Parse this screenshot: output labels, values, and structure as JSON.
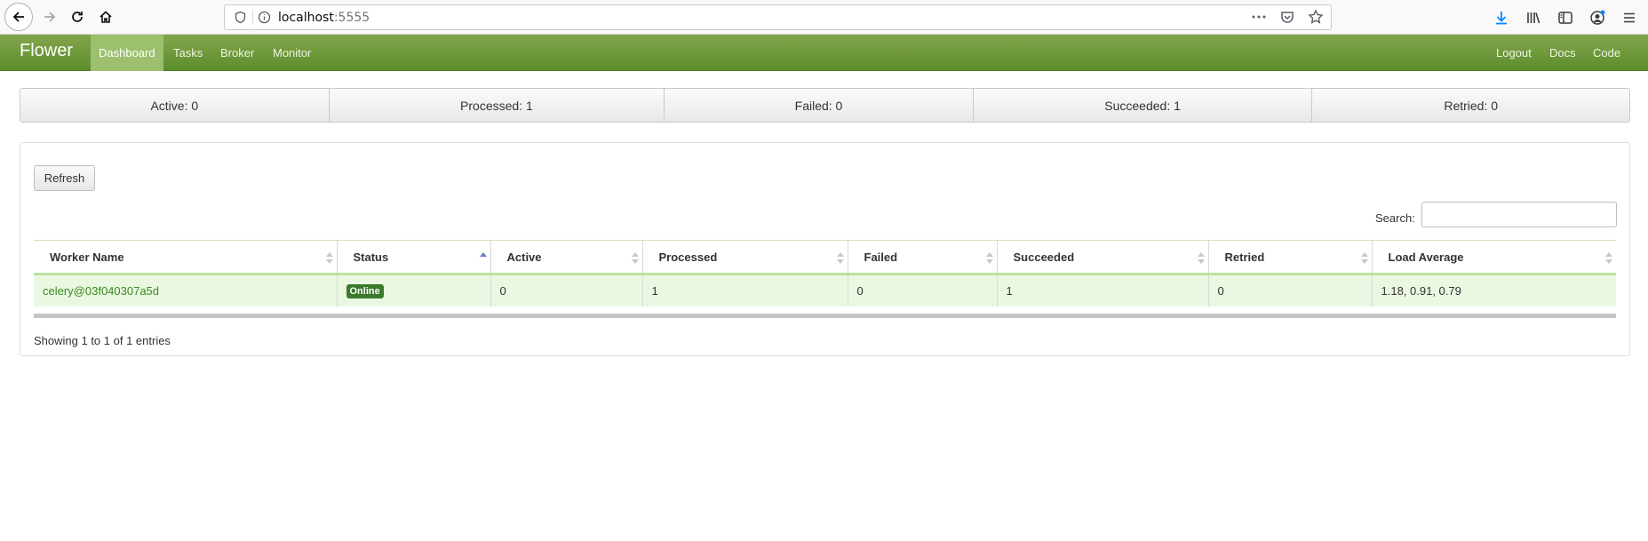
{
  "browser": {
    "url_host": "localhost",
    "url_port": ":5555"
  },
  "navbar": {
    "brand": "Flower",
    "items": [
      {
        "label": "Dashboard"
      },
      {
        "label": "Tasks"
      },
      {
        "label": "Broker"
      },
      {
        "label": "Monitor"
      }
    ],
    "right_items": [
      {
        "label": "Logout"
      },
      {
        "label": "Docs"
      },
      {
        "label": "Code"
      }
    ],
    "accent_color": "#6b9a3a"
  },
  "stats": [
    {
      "label": "Active: 0"
    },
    {
      "label": "Processed: 1"
    },
    {
      "label": "Failed: 0"
    },
    {
      "label": "Succeeded: 1"
    },
    {
      "label": "Retried: 0"
    }
  ],
  "panel": {
    "refresh_label": "Refresh",
    "search_label": "Search:",
    "search_value": "",
    "info": "Showing 1 to 1 of 1 entries"
  },
  "table": {
    "columns": [
      {
        "label": "Worker Name"
      },
      {
        "label": "Status"
      },
      {
        "label": "Active"
      },
      {
        "label": "Processed"
      },
      {
        "label": "Failed"
      },
      {
        "label": "Succeeded"
      },
      {
        "label": "Retried"
      },
      {
        "label": "Load Average"
      }
    ],
    "rows": [
      {
        "worker": "celery@03f040307a5d",
        "status": "Online",
        "active": "0",
        "processed": "1",
        "failed": "0",
        "succeeded": "1",
        "retried": "0",
        "load_average": "1.18, 0.91, 0.79"
      }
    ]
  }
}
